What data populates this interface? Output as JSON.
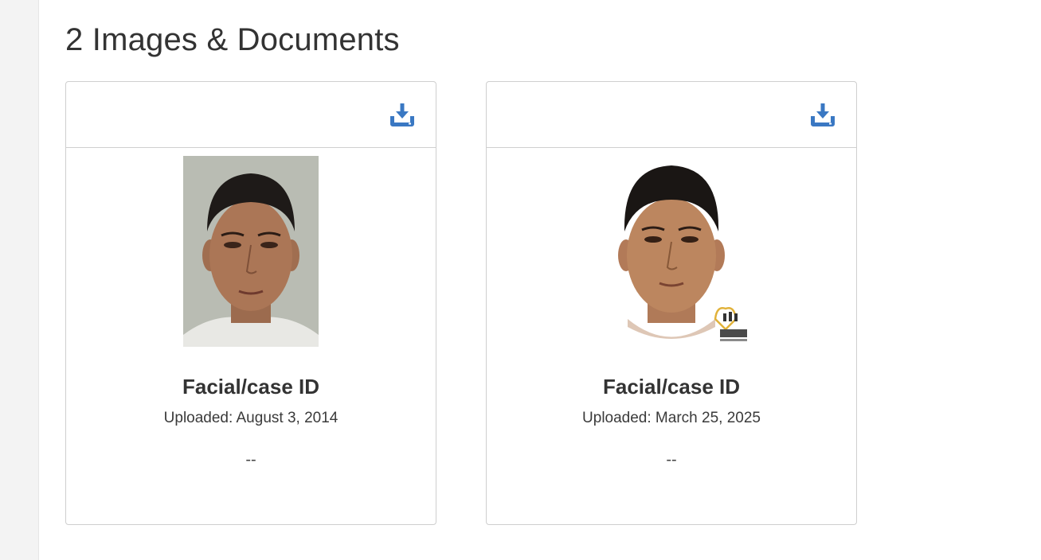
{
  "section": {
    "title": "2 Images & Documents"
  },
  "colors": {
    "accent": "#3a78c3",
    "border": "#cfcfcf",
    "text": "#333333"
  },
  "cards": [
    {
      "title": "Facial/case ID",
      "uploaded": "Uploaded: August 3, 2014",
      "description": "--",
      "image_kind": "photo",
      "download_icon": "download-tray-icon"
    },
    {
      "title": "Facial/case ID",
      "uploaded": "Uploaded: March 25, 2025",
      "description": "--",
      "image_kind": "forensic-reconstruction",
      "download_icon": "download-tray-icon"
    }
  ]
}
